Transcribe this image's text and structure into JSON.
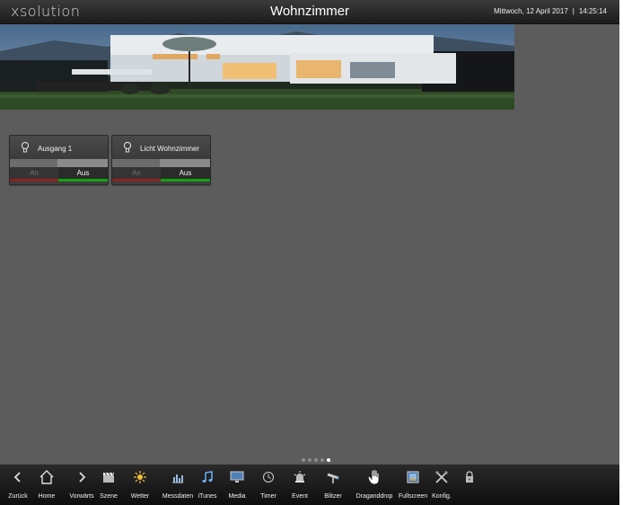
{
  "header": {
    "brand": "xsolution",
    "title": "Wohnzimmer",
    "date": "Mittwoch, 12 April 2017",
    "separator": "|",
    "time": "14:25:14"
  },
  "widgets": [
    {
      "label": "Ausgang 1",
      "on_label": "An",
      "off_label": "Aus",
      "state": "off"
    },
    {
      "label": "Licht Wohnzimmer",
      "on_label": "An",
      "off_label": "Aus",
      "state": "off"
    }
  ],
  "pagination": {
    "pages": 5,
    "active": 5
  },
  "toolbar": {
    "items": [
      {
        "label": "Zurück",
        "icon": "chevron-left-icon"
      },
      {
        "label": "Home",
        "icon": "home-icon"
      },
      {
        "label": "Vorwärts",
        "icon": "chevron-right-icon"
      },
      {
        "label": "Szene",
        "icon": "clapperboard-icon"
      },
      {
        "label": "Wetter",
        "icon": "sun-icon"
      },
      {
        "label": "Messdaten",
        "icon": "bar-chart-icon"
      },
      {
        "label": "iTunes",
        "icon": "music-note-icon"
      },
      {
        "label": "Media",
        "icon": "monitor-icon"
      },
      {
        "label": "Timer",
        "icon": "clock-icon"
      },
      {
        "label": "Event",
        "icon": "alarm-icon"
      },
      {
        "label": "Blitzer",
        "icon": "speed-camera-icon"
      },
      {
        "label": "Draganddrop",
        "icon": "drag-hand-icon"
      },
      {
        "label": "Fullscreen",
        "icon": "fullscreen-icon"
      },
      {
        "label": "Konfig.",
        "icon": "tools-icon"
      },
      {
        "label": "",
        "icon": "lock-icon"
      }
    ]
  },
  "colors": {
    "background": "#5c5c5c",
    "on_indicator": "#8a2222",
    "off_indicator": "#11a311"
  }
}
